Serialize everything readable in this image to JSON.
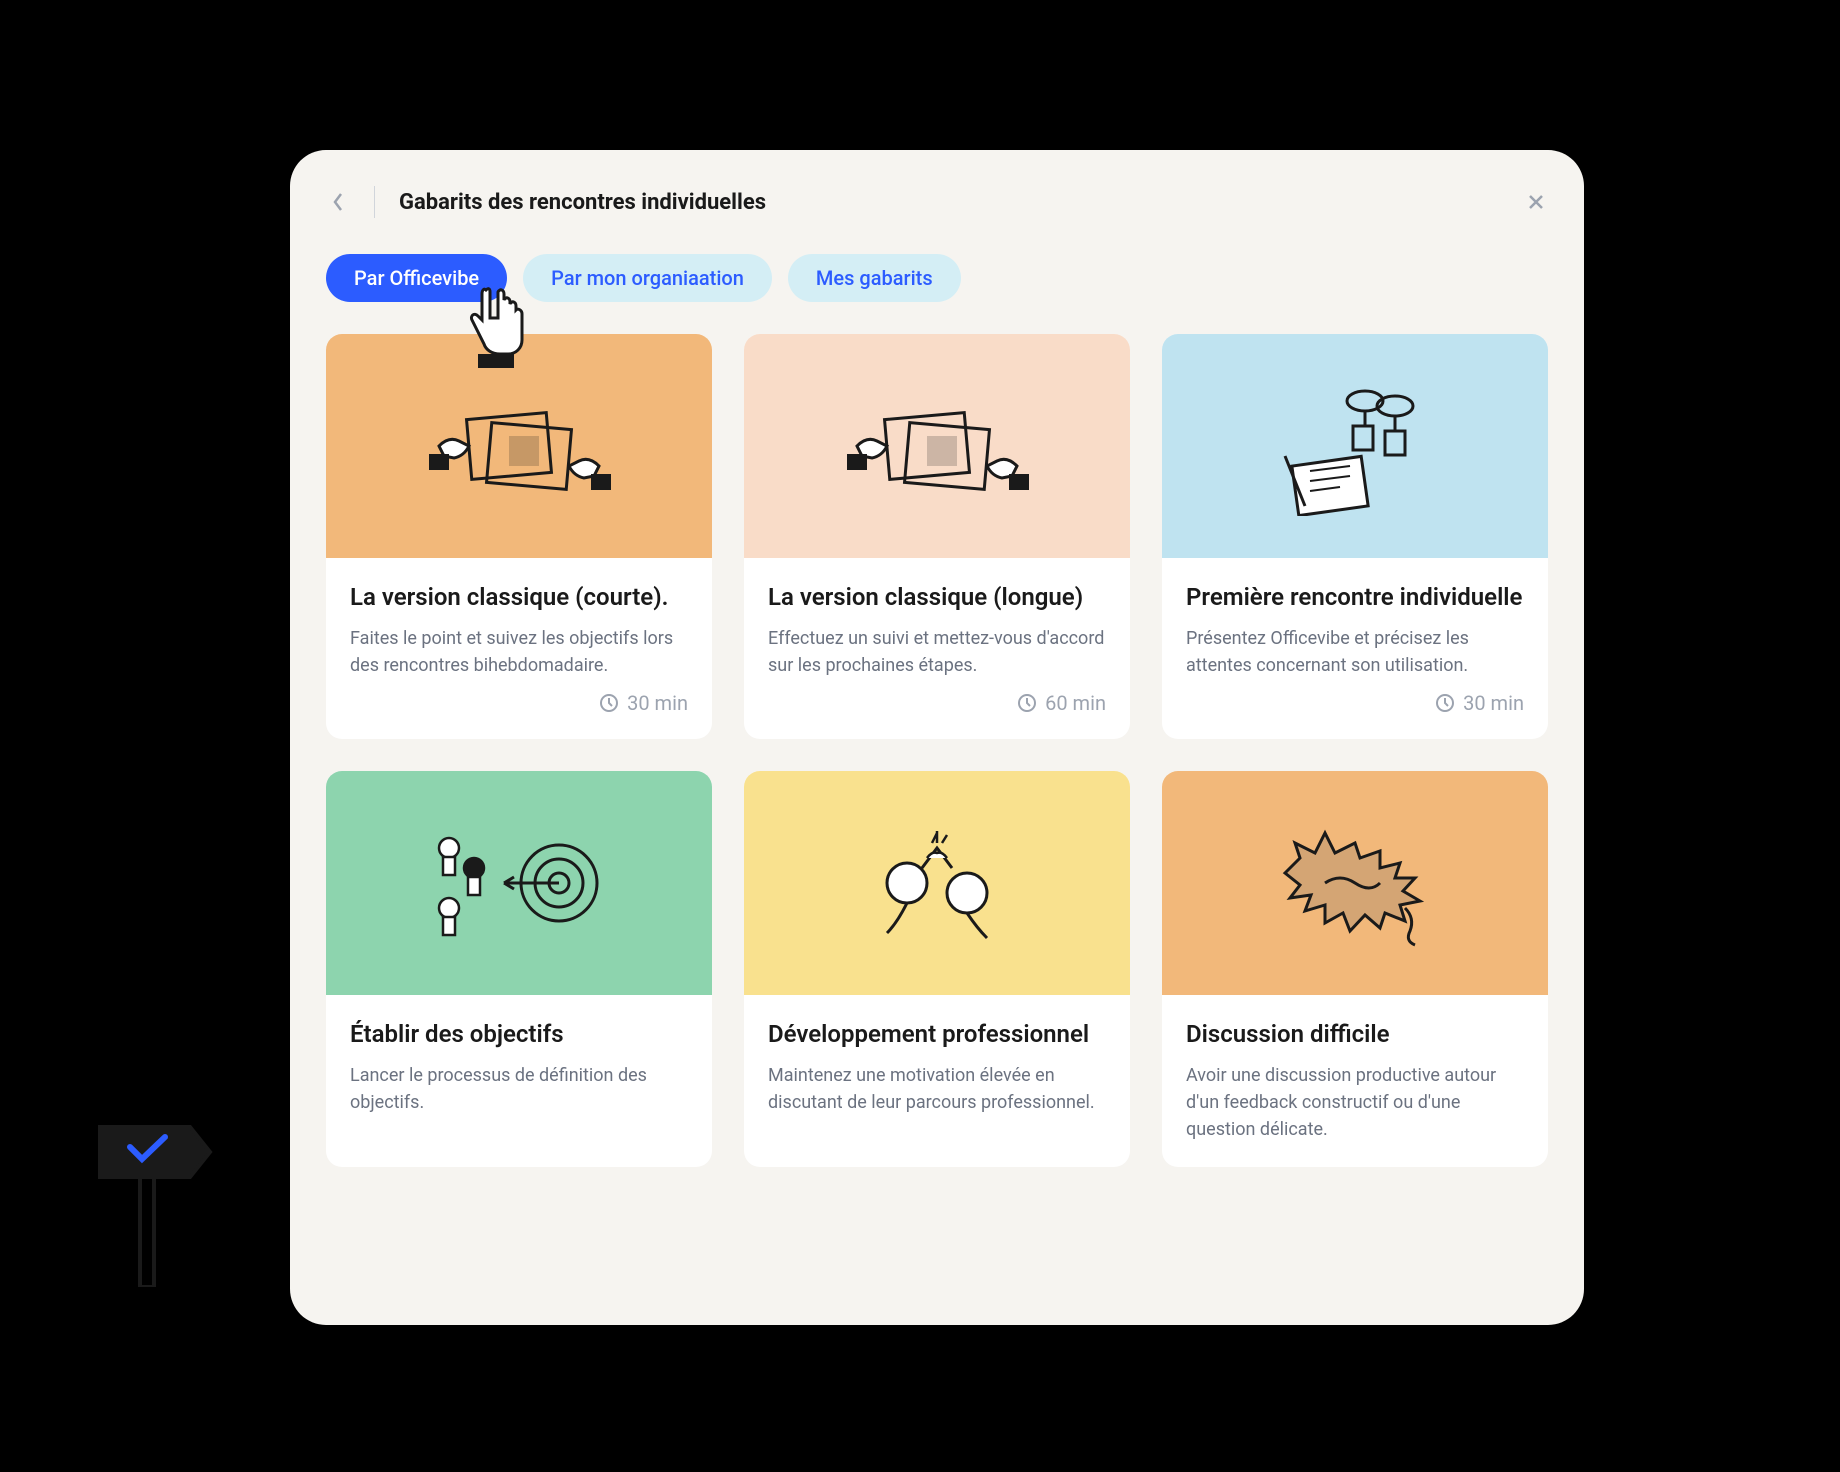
{
  "header": {
    "title": "Gabarits des rencontres individuelles"
  },
  "tabs": [
    {
      "label": "Par Officevibe",
      "active": true
    },
    {
      "label": "Par mon organiaation",
      "active": false
    },
    {
      "label": "Mes gabarits",
      "active": false
    }
  ],
  "cards": [
    {
      "title": "La version classique (courte).",
      "desc": "Faites le point et suivez les objectifs lors des rencontres bihebdomadaire.",
      "duration": "30 min",
      "color": "orange"
    },
    {
      "title": "La version classique (longue)",
      "desc": "Effectuez un suivi et mettez-vous d'accord sur les prochaines étapes.",
      "duration": "60 min",
      "color": "peach"
    },
    {
      "title": "Première rencontre individuelle",
      "desc": "Présentez Officevibe et précisez les attentes concernant son utilisation.",
      "duration": "30 min",
      "color": "blue"
    },
    {
      "title": "Établir des objectifs",
      "desc": "Lancer le processus de définition des objectifs.",
      "duration": "",
      "color": "green"
    },
    {
      "title": "Développement professionnel",
      "desc": "Maintenez une motivation élevée en discutant de leur parcours professionnel.",
      "duration": "",
      "color": "yellow"
    },
    {
      "title": "Discussion difficile",
      "desc": "Avoir une discussion productive autour d'un feedback constructif ou d'une question délicate.",
      "duration": "",
      "color": "orange2"
    }
  ]
}
